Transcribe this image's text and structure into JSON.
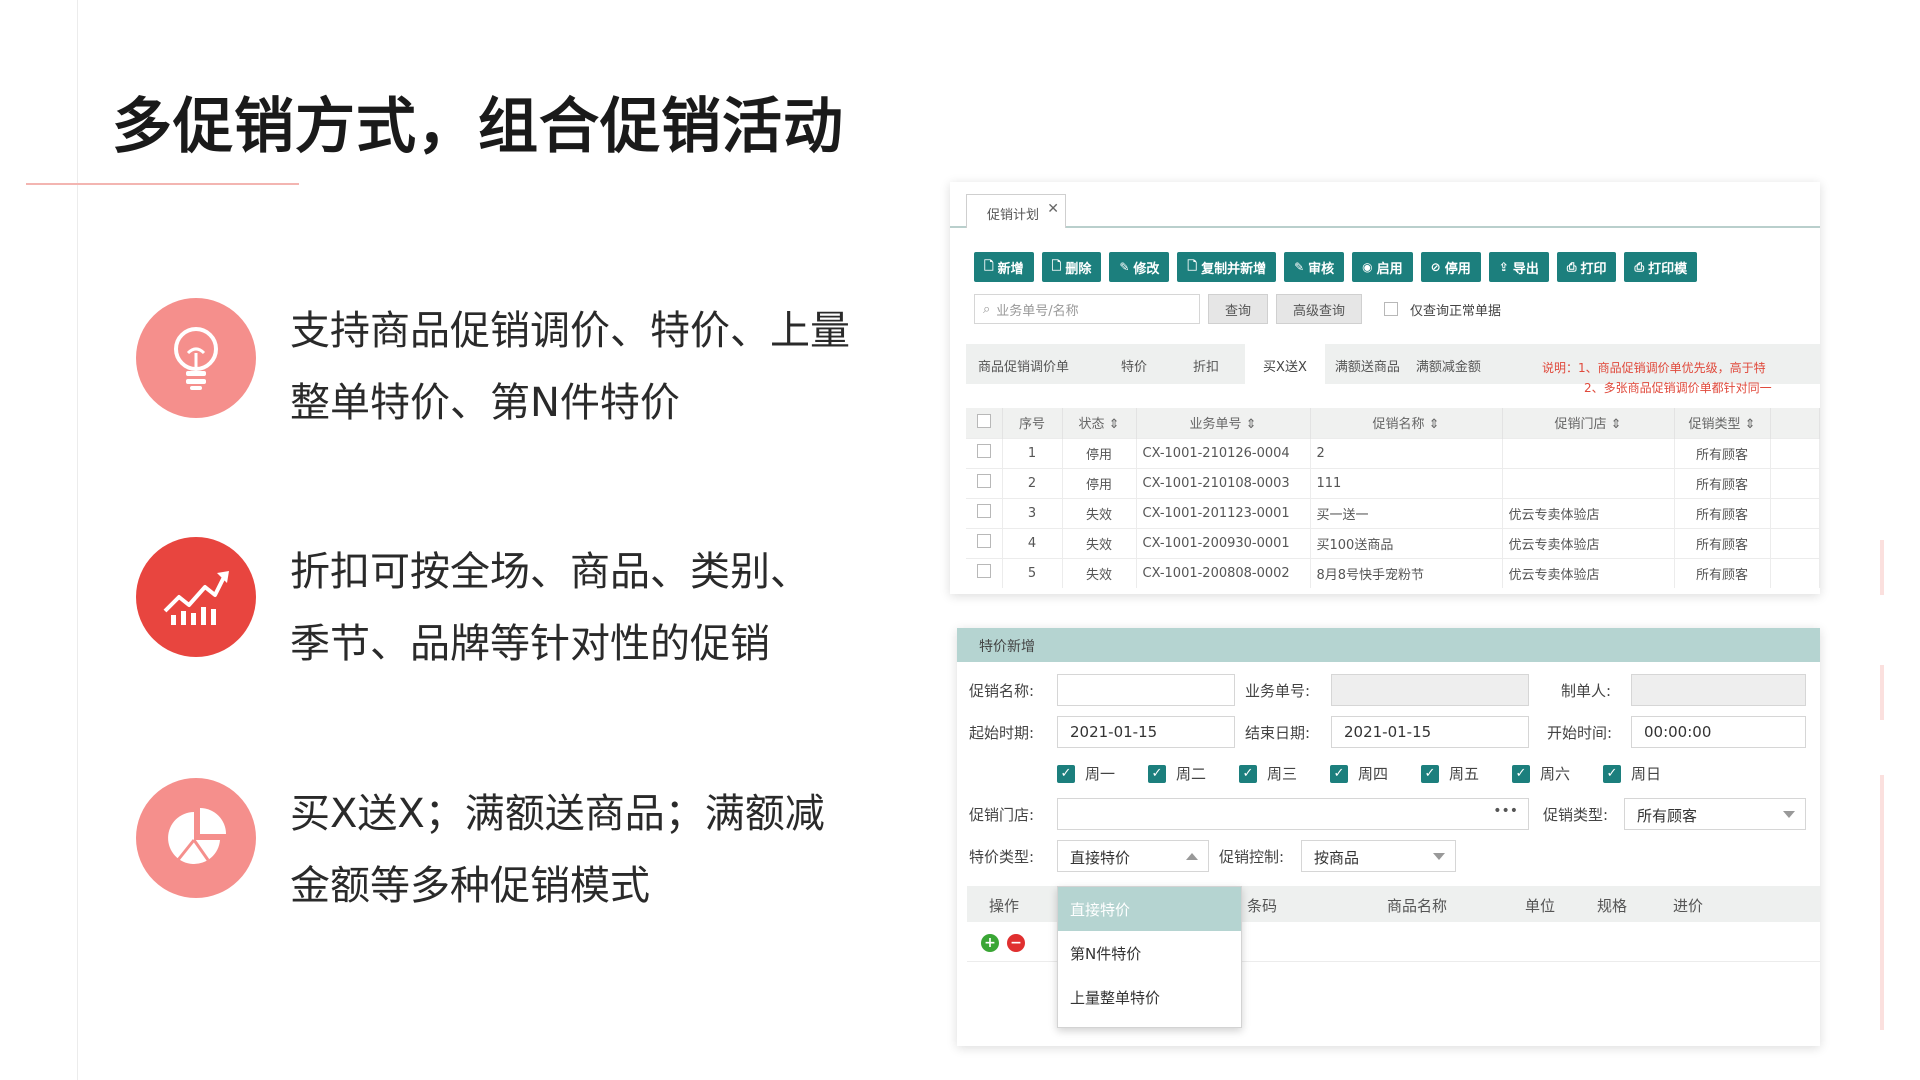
{
  "slide": {
    "title": "多促销方式，组合促销活动",
    "features": [
      {
        "icon": "lightbulb-icon",
        "line1": "支持商品促销调价、特价、上量",
        "line2": "整单特价、第N件特价"
      },
      {
        "icon": "chart-arrow-icon",
        "line1": "折扣可按全场、商品、类别、",
        "line2": "季节、品牌等针对性的促销"
      },
      {
        "icon": "pie-chart-icon",
        "line1": "买X送X；满额送商品；满额减",
        "line2": "金额等多种促销模式"
      }
    ]
  },
  "colors": {
    "accent": "#1c7f7d",
    "coral": "#f58f8c",
    "red": "#e8453f",
    "form_header": "#b5d4d1"
  },
  "plan_screen": {
    "tab_label": "促销计划",
    "toolbar": [
      {
        "label": "新增",
        "icon": "new-doc-icon"
      },
      {
        "label": "删除",
        "icon": "delete-doc-icon"
      },
      {
        "label": "修改",
        "icon": "edit-icon"
      },
      {
        "label": "复制并新增",
        "icon": "copy-doc-icon"
      },
      {
        "label": "审核",
        "icon": "approve-icon"
      },
      {
        "label": "启用",
        "icon": "enable-icon"
      },
      {
        "label": "停用",
        "icon": "disable-icon"
      },
      {
        "label": "导出",
        "icon": "export-icon"
      },
      {
        "label": "打印",
        "icon": "print-icon"
      },
      {
        "label": "打印模",
        "icon": "print-icon"
      }
    ],
    "search_placeholder": "业务单号/名称",
    "query_label": "查询",
    "advanced_label": "高级查询",
    "only_normal_label": "仅查询正常单据",
    "type_tabs": [
      "商品促销调价单",
      "特价",
      "折扣",
      "买X送X",
      "满额送商品",
      "满额减金额"
    ],
    "note_line1": "说明：1、商品促销调价单优先级，高于特",
    "note_line2": "2、多张商品促销调价单都针对同一",
    "columns": [
      "序号",
      "状态",
      "业务单号",
      "促销名称",
      "促销门店",
      "促销类型"
    ],
    "rows": [
      {
        "no": "1",
        "status": "停用",
        "doc": "CX-1001-210126-0004",
        "name": "2",
        "store": "",
        "type": "所有顾客"
      },
      {
        "no": "2",
        "status": "停用",
        "doc": "CX-1001-210108-0003",
        "name": "111",
        "store": "",
        "type": "所有顾客"
      },
      {
        "no": "3",
        "status": "失效",
        "doc": "CX-1001-201123-0001",
        "name": "买一送一",
        "store": "优云专卖体验店",
        "type": "所有顾客"
      },
      {
        "no": "4",
        "status": "失效",
        "doc": "CX-1001-200930-0001",
        "name": "买100送商品",
        "store": "优云专卖体验店",
        "type": "所有顾客"
      },
      {
        "no": "5",
        "status": "失效",
        "doc": "CX-1001-200808-0002",
        "name": "8月8号快手宠粉节",
        "store": "优云专卖体验店",
        "type": "所有顾客"
      }
    ]
  },
  "special_form": {
    "header": "特价新增",
    "promo_name_label": "促销名称",
    "doc_no_label": "业务单号",
    "maker_label": "制单人",
    "start_date_label": "起始时期",
    "start_date_value": "2021-01-15",
    "end_date_label": "结束日期",
    "end_date_value": "2021-01-15",
    "start_time_label": "开始时间",
    "start_time_value": "00:00:00",
    "weekdays": [
      "周一",
      "周二",
      "周三",
      "周四",
      "周五",
      "周六",
      "周日"
    ],
    "store_label": "促销门店",
    "store_more": "•••",
    "promo_type_label": "促销类型",
    "promo_type_value": "所有顾客",
    "price_type_label": "特价类型",
    "price_type_value": "直接特价",
    "control_label": "促销控制",
    "control_value": "按商品",
    "grid_columns": {
      "op": "操作",
      "code": "条码",
      "name": "商品名称",
      "unit": "单位",
      "spec": "规格",
      "cost": "进价"
    },
    "dropdown_options": [
      "直接特价",
      "第N件特价",
      "上量整单特价"
    ]
  }
}
